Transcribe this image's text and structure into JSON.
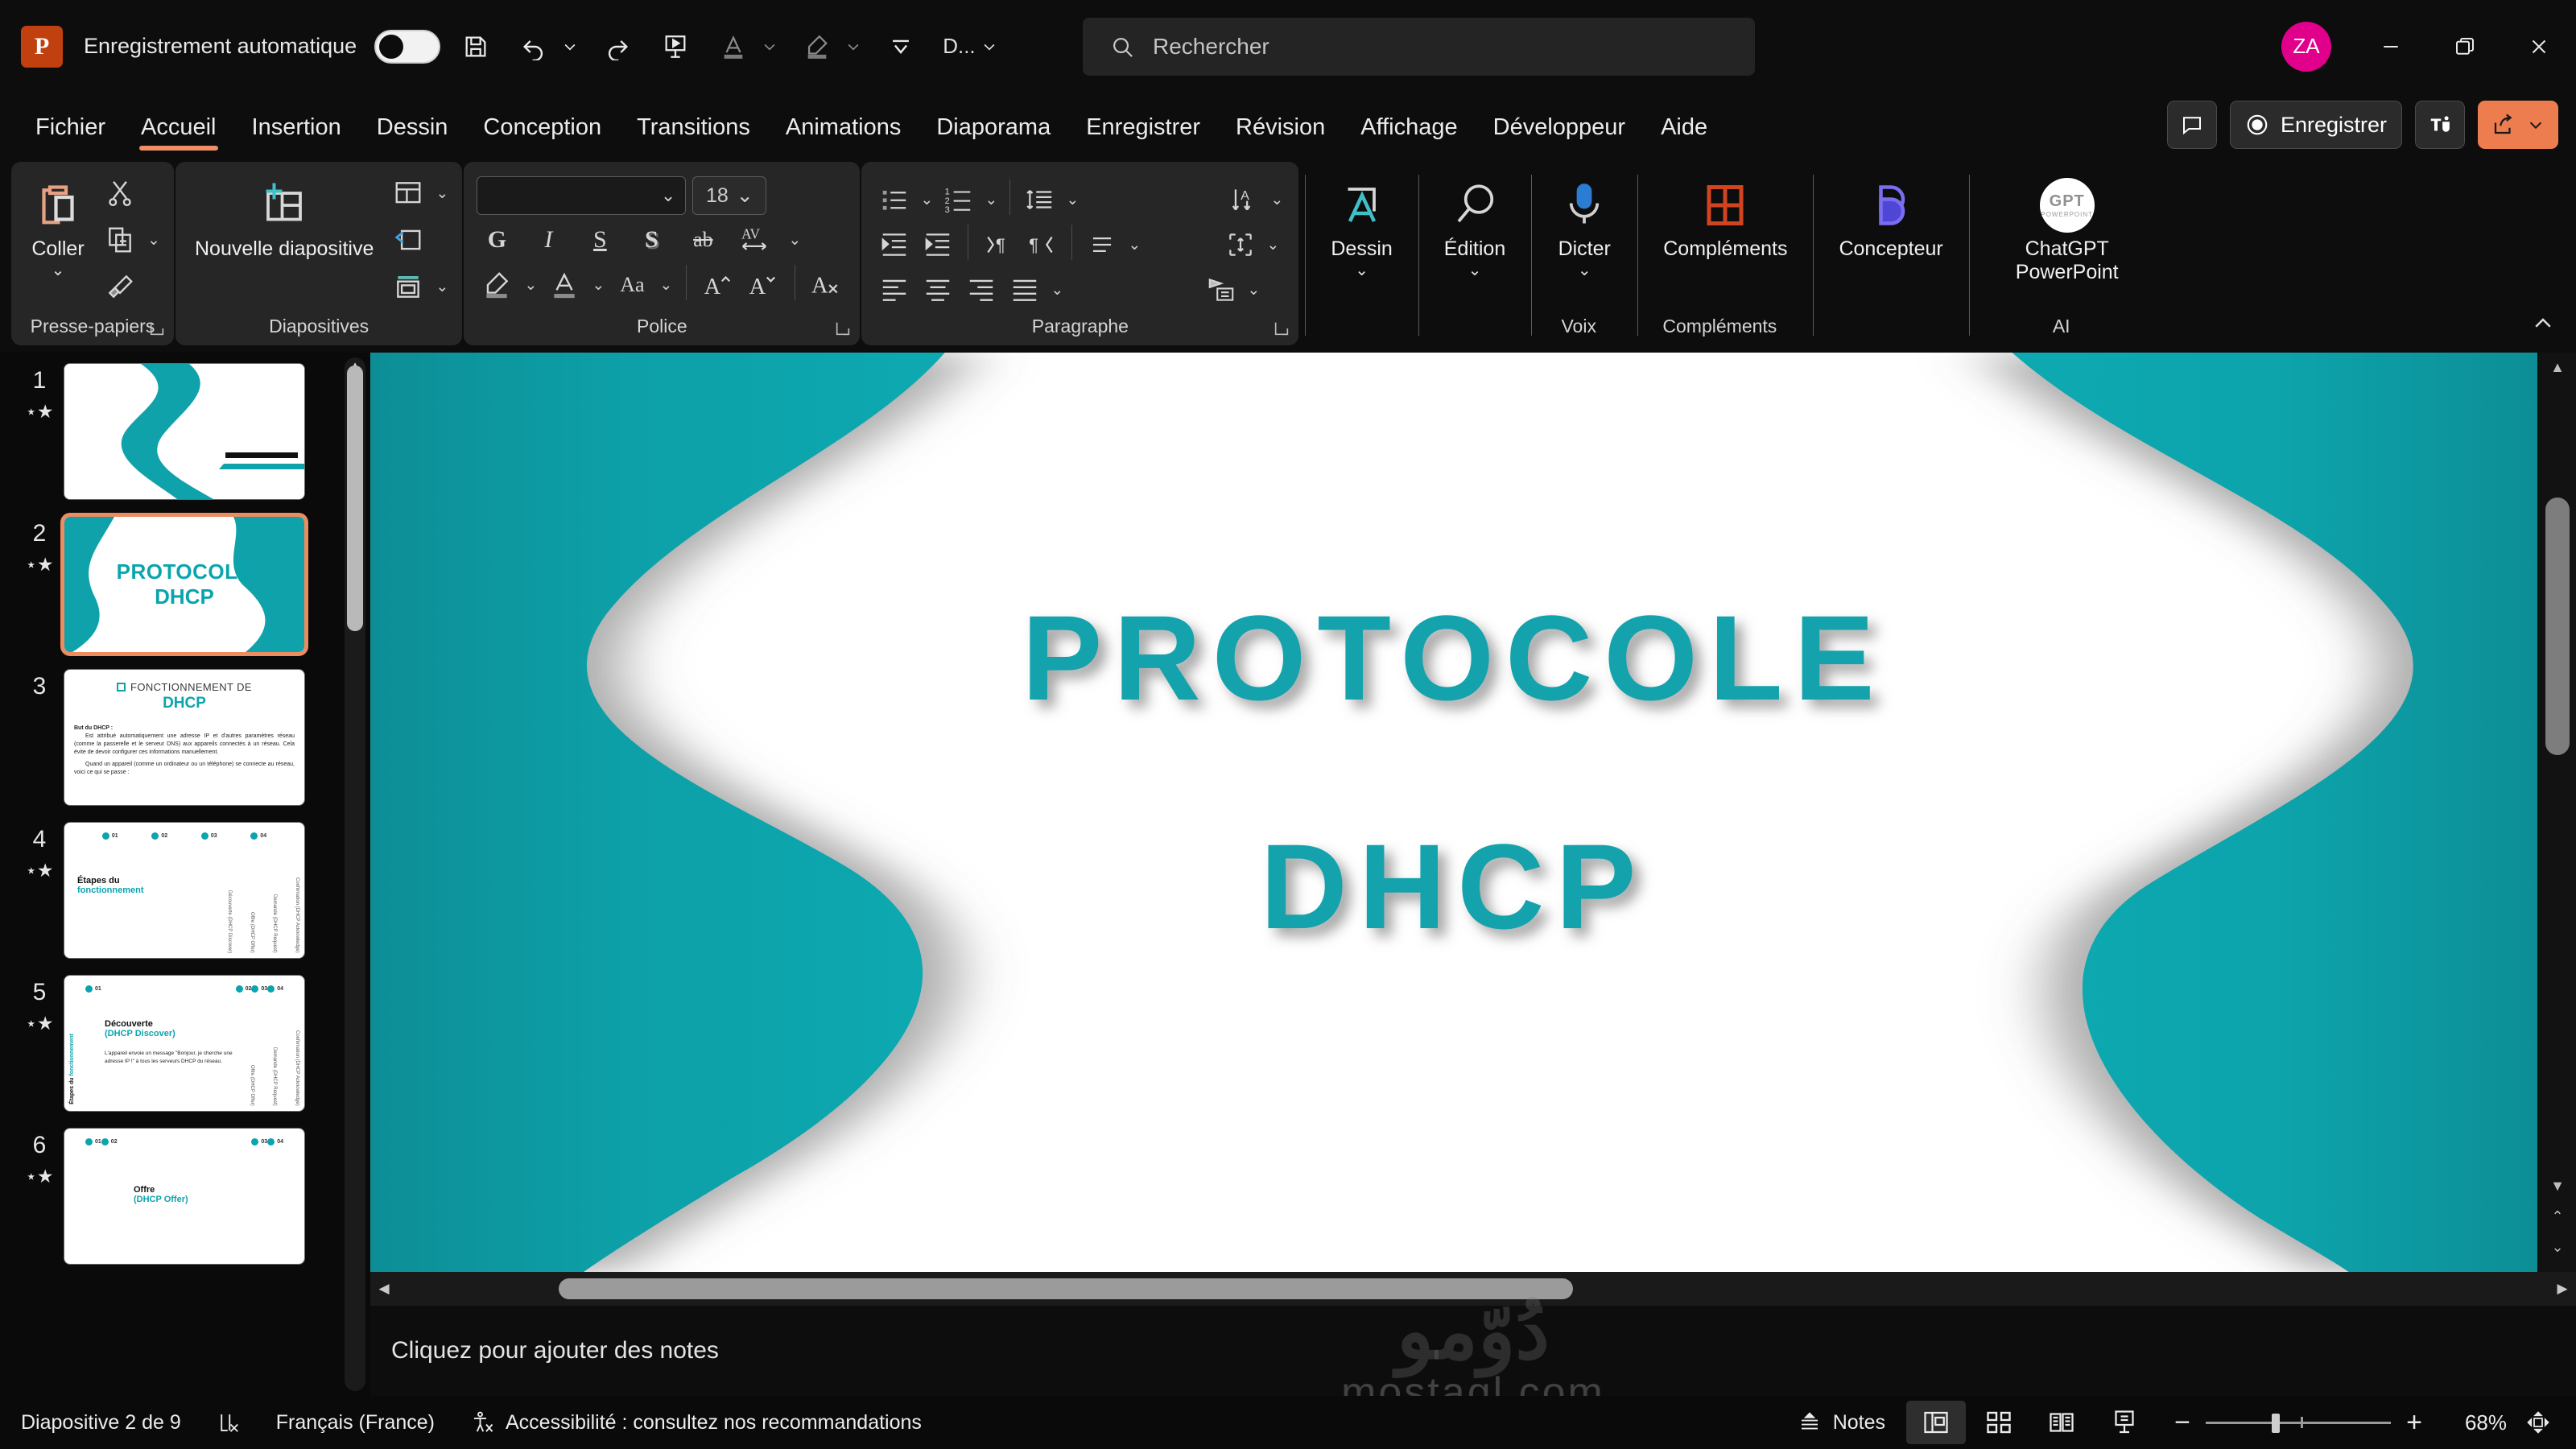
{
  "titlebar": {
    "app_icon": "powerpoint-logo",
    "app_letter": "P",
    "autosave_label": "Enregistrement automatique",
    "autosave_state": "off",
    "quick_access": [
      {
        "name": "save-icon",
        "label": "Enregistrer"
      },
      {
        "name": "undo-icon",
        "label": "Annuler"
      },
      {
        "name": "redo-icon",
        "label": "Rétablir"
      },
      {
        "name": "start-slideshow-icon",
        "label": "Démarrer le diaporama"
      },
      {
        "name": "font-color-icon",
        "label": "Couleur de police"
      },
      {
        "name": "highlight-icon",
        "label": "Surlignage"
      },
      {
        "name": "fill-icon",
        "label": "Remplissage"
      }
    ],
    "doc_name": "D...",
    "search_placeholder": "Rechercher",
    "avatar_initials": "ZA",
    "window_buttons": [
      "minimize",
      "restore",
      "close"
    ]
  },
  "tabs": [
    {
      "label": "Fichier",
      "active": false
    },
    {
      "label": "Accueil",
      "active": true
    },
    {
      "label": "Insertion",
      "active": false
    },
    {
      "label": "Dessin",
      "active": false
    },
    {
      "label": "Conception",
      "active": false
    },
    {
      "label": "Transitions",
      "active": false
    },
    {
      "label": "Animations",
      "active": false
    },
    {
      "label": "Diaporama",
      "active": false
    },
    {
      "label": "Enregistrer",
      "active": false
    },
    {
      "label": "Révision",
      "active": false
    },
    {
      "label": "Affichage",
      "active": false
    },
    {
      "label": "Développeur",
      "active": false
    },
    {
      "label": "Aide",
      "active": false
    }
  ],
  "tabs_right": {
    "comments_label": "Commentaires",
    "record_label": "Enregistrer",
    "teams_label": "Teams",
    "share_label": "Partager"
  },
  "ribbon": {
    "groups": [
      {
        "title": "Presse-papiers",
        "paste_label": "Coller",
        "items": [
          "cut-icon",
          "copy-icon",
          "format-painter-icon"
        ]
      },
      {
        "title": "Diapositives",
        "new_slide_label": "Nouvelle diapositive",
        "items": [
          "layout-icon",
          "reset-icon",
          "section-icon"
        ]
      },
      {
        "title": "Police",
        "font_name": "",
        "font_size": "18",
        "buttons": [
          "G",
          "I",
          "S",
          "S",
          "ab",
          "AV"
        ],
        "row2": [
          "text-highlight-icon",
          "font-color-icon",
          "change-case-icon",
          "increase-font-icon",
          "decrease-font-icon",
          "clear-formatting-icon"
        ]
      },
      {
        "title": "Paragraphe",
        "row1": [
          "bullets-icon",
          "numbering-icon",
          "line-spacing-icon",
          "text-direction-icon"
        ],
        "row2": [
          "decrease-indent-icon",
          "increase-indent-icon",
          "ltr-icon",
          "rtl-icon",
          "align-text-icon",
          "text-box-autofit-icon"
        ],
        "row3": [
          "align-left-icon",
          "align-center-icon",
          "align-right-icon",
          "justify-icon",
          "convert-smartart-icon"
        ]
      },
      {
        "title": "",
        "draw_label": "Dessin"
      },
      {
        "title": "",
        "edit_label": "Édition"
      },
      {
        "title": "Voix",
        "dictate_label": "Dicter"
      },
      {
        "title": "Compléments",
        "addins_label": "Compléments"
      },
      {
        "title": "",
        "designer_label": "Concepteur"
      },
      {
        "title": "AI",
        "chatgpt_label": "ChatGPT PowerPoint",
        "logo_text": "GPT",
        "logo_sub": "POWERPOINT"
      }
    ],
    "collapse_label": "Réduire le ruban"
  },
  "thumbnails": [
    {
      "num": "1",
      "has_star": true,
      "selected": false,
      "type": "cover",
      "title": "",
      "subtitle": ""
    },
    {
      "num": "2",
      "has_star": true,
      "selected": true,
      "type": "title",
      "title": "PROTOCOLE",
      "subtitle": "DHCP"
    },
    {
      "num": "3",
      "has_star": false,
      "selected": false,
      "type": "content",
      "heading1": "FONCTIONNEMENT DE",
      "heading2": "DHCP",
      "body_lead": "But du DHCP :",
      "body_p1": "Est attribué automatiquement une adresse IP et d'autres paramètres réseau (comme la passerelle et le serveur DNS) aux appareils connectés à un réseau. Cela évite de devoir configurer ces informations manuellement.",
      "body_p2": "Quand un appareil (comme un ordinateur ou un téléphone) se connecte au réseau, voici ce qui se passe :"
    },
    {
      "num": "4",
      "has_star": true,
      "selected": false,
      "type": "steps",
      "title1": "Étapes du",
      "title2": "fonctionnement",
      "dots": [
        "01",
        "02",
        "03",
        "04"
      ],
      "vlabels": [
        "Découverte (DHCP Discover)",
        "Offre (DHCP Offer)",
        "Demande (DHCP Request)",
        "Confirmation (DHCP Acknowledge)"
      ]
    },
    {
      "num": "5",
      "has_star": true,
      "selected": false,
      "type": "step-detail",
      "dots": [
        "01",
        "02",
        "03",
        "04"
      ],
      "title1": "Découverte",
      "title2": "(DHCP Discover)",
      "body": "L'appareil envoie un message \"Bonjour, je cherche une adresse IP !\" à tous les serveurs DHCP du réseau.",
      "side1": "Étapes du",
      "side2": "fonctionnement",
      "vlabels": [
        "Offre (DHCP Offer)",
        "Demande (DHCP Request)",
        "Confirmation (DHCP Acknowledge)"
      ]
    },
    {
      "num": "6",
      "has_star": true,
      "selected": false,
      "type": "step-detail",
      "dots": [
        "01",
        "02",
        "03",
        "04"
      ],
      "title1": "Offre",
      "title2": "(DHCP Offer)",
      "body": "",
      "side1": "",
      "side2": "",
      "vlabels": []
    }
  ],
  "slide": {
    "title": "PROTOCOLE",
    "subtitle": "DHCP",
    "accent_color": "#14a3ad",
    "background": "#ffffff"
  },
  "watermark": {
    "line1": "دُوّمو",
    "line2": "mostaql.com"
  },
  "notes": {
    "placeholder": "Cliquez pour ajouter des notes"
  },
  "statusbar": {
    "slide_counter": "Diapositive 2 de 9",
    "spellcheck_icon": "spellcheck-icon",
    "language": "Français (France)",
    "accessibility": "Accessibilité : consultez nos recommandations",
    "notes_label": "Notes",
    "views": [
      {
        "name": "normal-view-icon",
        "active": true
      },
      {
        "name": "slide-sorter-icon",
        "active": false
      },
      {
        "name": "reading-view-icon",
        "active": false
      },
      {
        "name": "slideshow-icon",
        "active": false
      }
    ],
    "zoom_minus": "−",
    "zoom_plus": "+",
    "zoom_level": "68%",
    "fit_label": "Ajuster la diapositive à la fenêtre active"
  }
}
